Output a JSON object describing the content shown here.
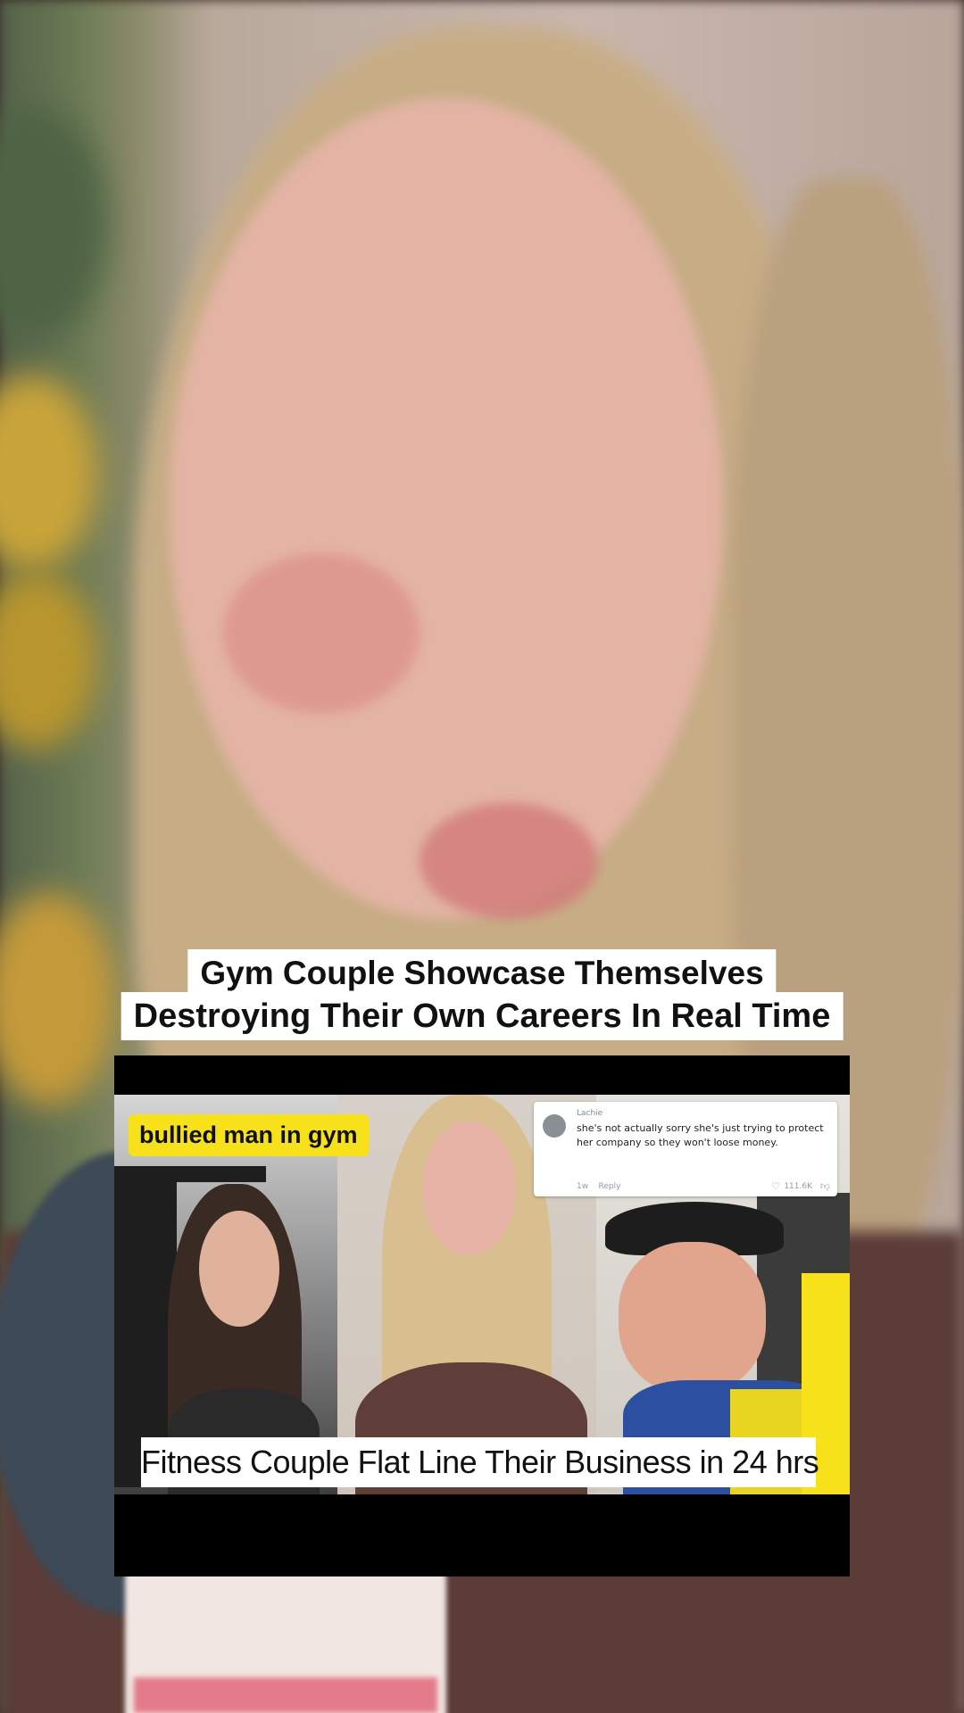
{
  "overlay": {
    "title_line_1": "Gym Couple Showcase Themselves",
    "title_line_2": "Destroying Their Own Careers In Real Time"
  },
  "thumbnail": {
    "badge": "bullied man in gym",
    "comment": {
      "username": "Lachie",
      "text": "she's not actually sorry she's just trying to protect her company so they won't loose money.",
      "time": "1w",
      "reply_label": "Reply",
      "likes": "111.6K"
    },
    "headline": "Fitness Couple Flat Line Their Business in 24 hrs",
    "accent_color": "#f7e11b"
  }
}
